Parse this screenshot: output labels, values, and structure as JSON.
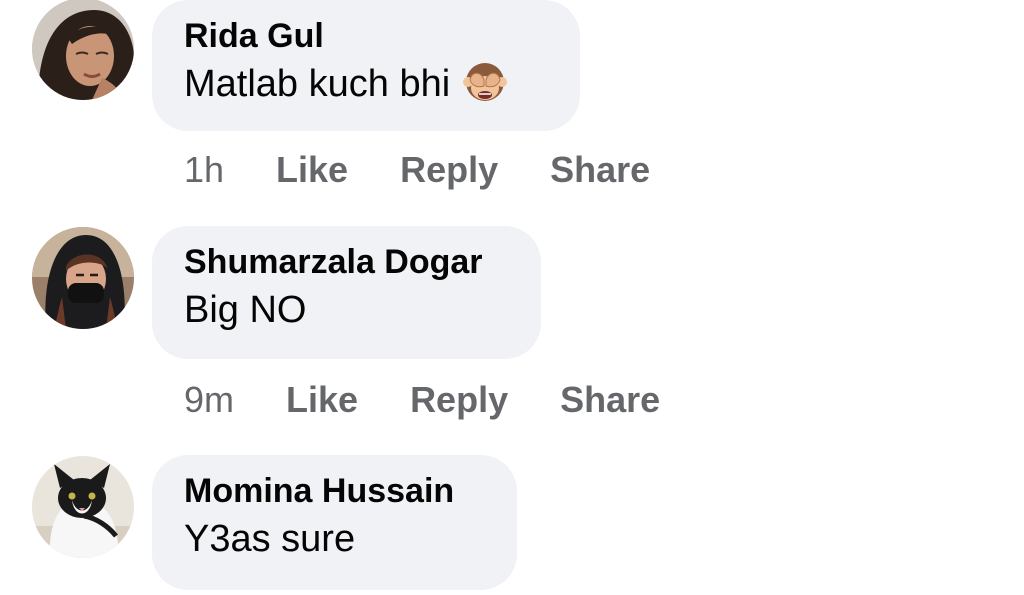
{
  "comments": [
    {
      "author": "Rida Gul",
      "text": "Matlab kuch bhi",
      "emoji": "see-no-evil-monkey-icon",
      "time": "1h",
      "actions": {
        "like": "Like",
        "reply": "Reply",
        "share": "Share"
      }
    },
    {
      "author": "Shumarzala Dogar",
      "text": "Big NO",
      "time": "9m",
      "actions": {
        "like": "Like",
        "reply": "Reply",
        "share": "Share"
      }
    },
    {
      "author": "Momina Hussain",
      "text": "Y3as sure"
    }
  ],
  "colors": {
    "bubble": "#f0f2f5",
    "meta_text": "#65676b",
    "primary_text": "#050505"
  }
}
